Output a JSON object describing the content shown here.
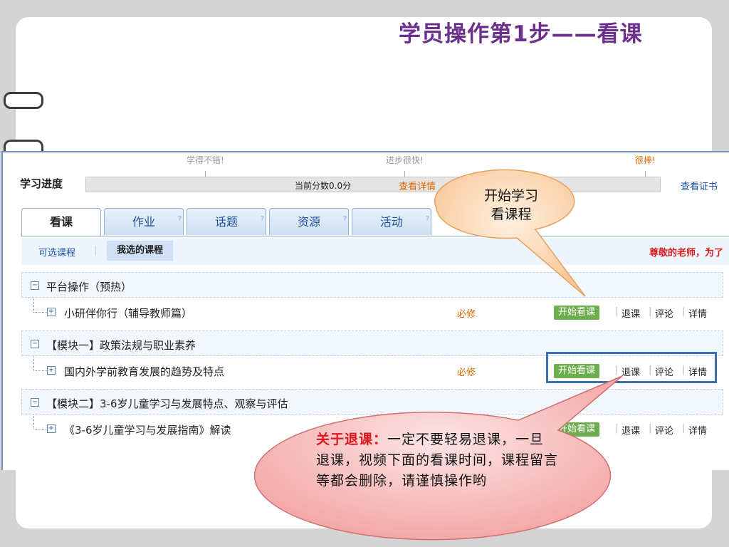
{
  "slide": {
    "title": "学员操作第1步——看课"
  },
  "progress": {
    "label": "学习进度",
    "milestones": [
      "学得不错!",
      "进步很快!",
      "很棒!"
    ],
    "score_text": "当前分数0.0分",
    "detail_link": "查看详情",
    "cert_link": "查看证书"
  },
  "tabs": [
    {
      "label": "看课",
      "active": true
    },
    {
      "label": "作业",
      "help": "?"
    },
    {
      "label": "话题",
      "help": "?"
    },
    {
      "label": "资源",
      "help": "?"
    },
    {
      "label": "活动",
      "help": "?"
    }
  ],
  "subnav": {
    "all_courses": "可选课程",
    "separator": "|",
    "my_courses": "我选的课程",
    "notice": "尊敬的老师，为了"
  },
  "modules": [
    {
      "toggle": "−",
      "title": "平台操作（预热）",
      "courses": [
        {
          "toggle": "+",
          "title": "小研伴你行（辅导教师篇）",
          "required": "必修",
          "start": "开始看课",
          "drop": "退课",
          "comment": "评论",
          "detail": "详情"
        }
      ]
    },
    {
      "toggle": "−",
      "title": "【模块一】政策法规与职业素养",
      "courses": [
        {
          "toggle": "+",
          "title": "国内外学前教育发展的趋势及特点",
          "required": "必修",
          "start": "开始看课",
          "drop": "退课",
          "comment": "评论",
          "detail": "详情"
        }
      ]
    },
    {
      "toggle": "−",
      "title": "【模块二】3-6岁儿童学习与发展特点、观察与评估",
      "courses": [
        {
          "toggle": "+",
          "title": "《3-6岁儿童学习与发展指南》解读",
          "required": "",
          "start": "开始看课",
          "drop": "退课",
          "comment": "评论",
          "detail": "详情"
        }
      ]
    }
  ],
  "callouts": {
    "start_line1": "开始学习",
    "start_line2": "看课程",
    "drop_emphasis": "关于退课：",
    "drop_text": "一定不要轻易退课，一旦退课，视频下面的看课时间，课程留言等都会删除，请谨慎操作哟"
  },
  "colors": {
    "title_purple": "#6b2f8e",
    "start_button_green": "#6cae4e",
    "required_orange": "#e06a00",
    "highlight_blue": "#3b6fb0",
    "emphasis_red": "#e0141e"
  }
}
